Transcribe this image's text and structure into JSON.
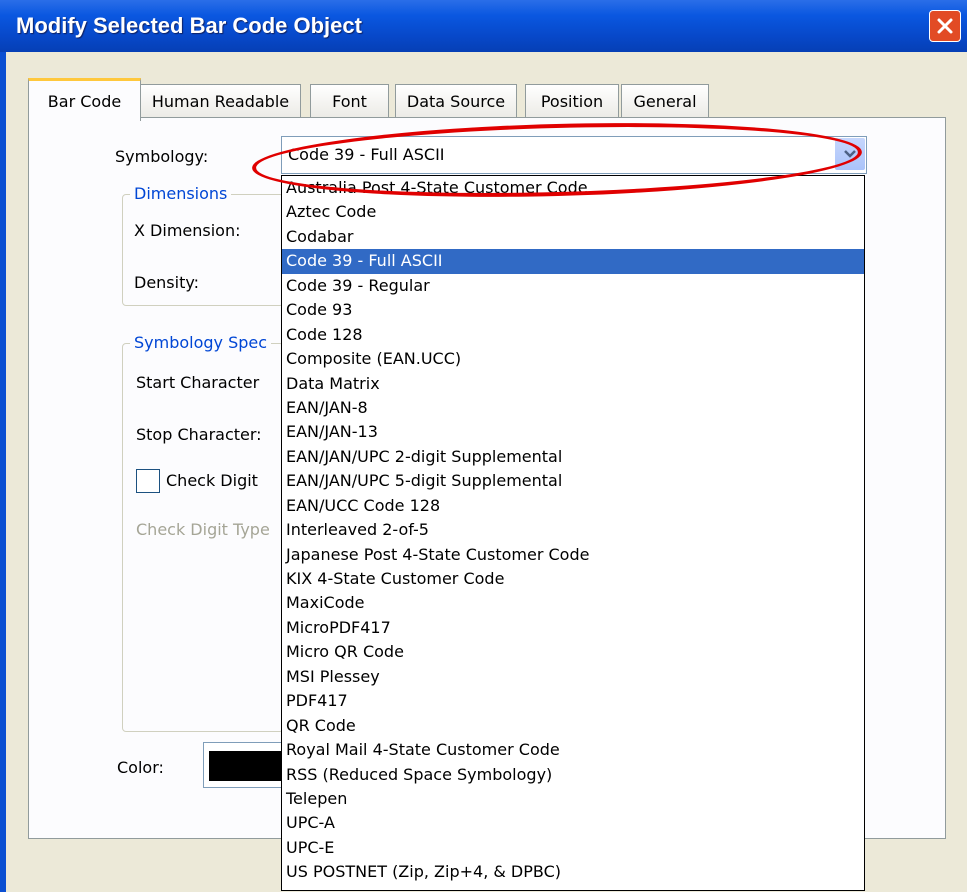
{
  "window": {
    "title": "Modify Selected Bar Code Object"
  },
  "tabs": [
    "Bar Code",
    "Human Readable",
    "Font",
    "Data Source",
    "Position",
    "General"
  ],
  "form": {
    "symbology_label": "Symbology:",
    "dimensions_group": "Dimensions",
    "x_dimension_label": "X Dimension:",
    "density_label": "Density:",
    "symbology_specific_group": "Symbology Spec",
    "start_character_label": "Start Character",
    "stop_character_label": "Stop Character:",
    "check_digit_label": "Check Digit",
    "check_digit_type_label": "Check Digit Type",
    "color_label": "Color:",
    "color_value": "#000000"
  },
  "symbology": {
    "selected": "Code 39 - Full ASCII",
    "options": [
      "Australia Post 4-State Customer Code",
      "Aztec Code",
      "Codabar",
      "Code 39 - Full ASCII",
      "Code 39 - Regular",
      "Code 93",
      "Code 128",
      "Composite (EAN.UCC)",
      "Data Matrix",
      "EAN/JAN-8",
      "EAN/JAN-13",
      "EAN/JAN/UPC 2-digit Supplemental",
      "EAN/JAN/UPC 5-digit Supplemental",
      "EAN/UCC Code 128",
      "Interleaved 2-of-5",
      "Japanese Post 4-State Customer Code",
      "KIX 4-State Customer Code",
      "MaxiCode",
      "MicroPDF417",
      "Micro QR Code",
      "MSI Plessey",
      "PDF417",
      "QR Code",
      "Royal Mail 4-State Customer Code",
      "RSS (Reduced Space Symbology)",
      "Telepen",
      "UPC-A",
      "UPC-E",
      "US POSTNET (Zip, Zip+4, & DPBC)"
    ]
  },
  "colors": {
    "highlight": "#316ac5",
    "annotation": "#e00000",
    "titlebar": "#0748c9"
  }
}
